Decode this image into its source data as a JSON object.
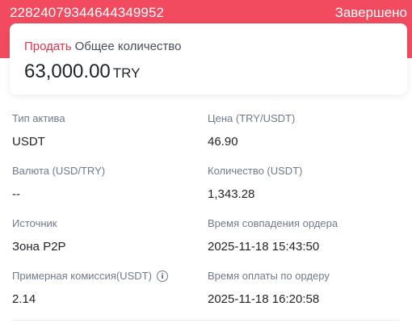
{
  "header": {
    "order_id": "22824079344644349952",
    "status": "Завершено",
    "color": "#f24b5f"
  },
  "summary": {
    "side": "Продать",
    "side_color": "#e0354a",
    "total_label": "Общее количество",
    "amount": "63,000.00",
    "currency": "TRY"
  },
  "details": {
    "asset_type": {
      "label": "Тип актива",
      "value": "USDT"
    },
    "price": {
      "label": "Цена (TRY/USDT)",
      "value": "46.90"
    },
    "currency_pair": {
      "label": "Валюта (USD/TRY)",
      "value": "--"
    },
    "quantity": {
      "label": "Количество (USDT)",
      "value": "1,343.28"
    },
    "source": {
      "label": "Источник",
      "value": "Зона P2P"
    },
    "match_time": {
      "label": "Время совпадения ордера",
      "value": "2025-11-18 15:43:50"
    },
    "fee": {
      "label": "Примерная комиссия(USDT)",
      "value": "2.14",
      "icon": "info-icon"
    },
    "payment_time": {
      "label": "Время оплаты по ордеру",
      "value": "2025-11-18 16:20:58"
    }
  }
}
